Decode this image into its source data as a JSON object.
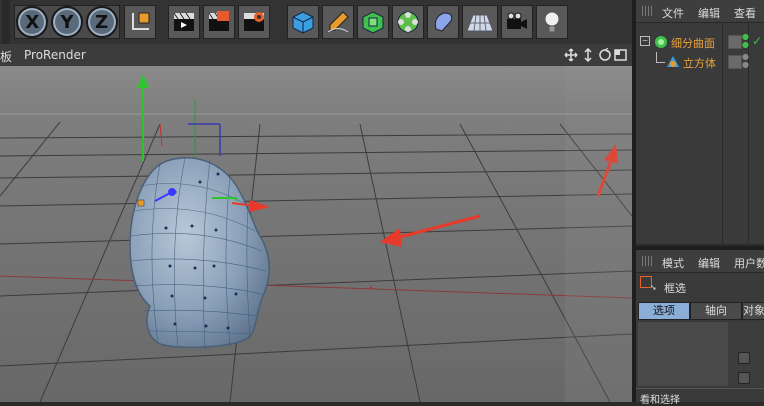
{
  "toolbar": {
    "axis_buttons": [
      "X",
      "Y",
      "Z"
    ],
    "tools": [
      "coordinate-system",
      "render-view",
      "render-picture-viewer",
      "render-settings",
      "cube",
      "pen",
      "subdivision",
      "mograph",
      "deformer",
      "floor",
      "camera",
      "light"
    ]
  },
  "viewport": {
    "left_label": "板",
    "renderer_label": "ProRender",
    "grid_color": "#3a3a3a",
    "background_color": "#7a7a7a"
  },
  "object_manager": {
    "menu": [
      "文件",
      "编辑",
      "查看"
    ],
    "objects": [
      {
        "name": "细分曲面",
        "icon": "subdivision-icon"
      },
      {
        "name": "立方体",
        "icon": "cube-icon"
      }
    ]
  },
  "attribute_manager": {
    "menu": [
      "模式",
      "编辑",
      "用户数据"
    ],
    "selection_label": "框选",
    "tabs": [
      "选项",
      "轴向",
      "对象"
    ],
    "bottom_label": "看和选择"
  },
  "annotation_color": "#e83a2a"
}
